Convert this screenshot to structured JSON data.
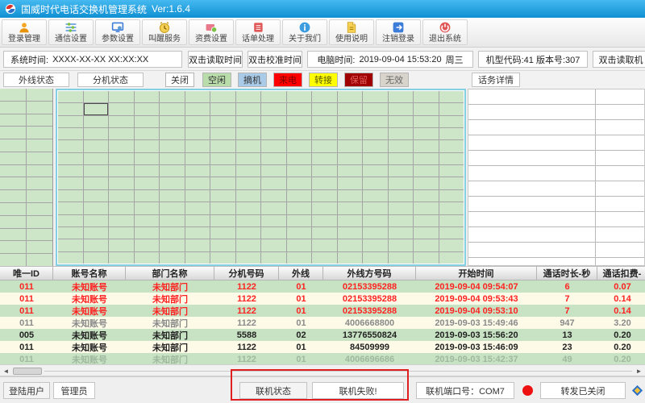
{
  "window": {
    "title": "国威时代电话交换机管理系统",
    "version": "Ver:1.6.4"
  },
  "toolbar": {
    "buttons": [
      {
        "label": "登录管理",
        "icon": "user-icon"
      },
      {
        "label": "通信设置",
        "icon": "sliders-icon"
      },
      {
        "label": "参数设置",
        "icon": "monitor-gear-icon"
      },
      {
        "label": "叫醒服务",
        "icon": "alarm-clock-icon"
      },
      {
        "label": "资费设置",
        "icon": "wallet-icon"
      },
      {
        "label": "话单处理",
        "icon": "bill-icon"
      },
      {
        "label": "关于我们",
        "icon": "info-icon"
      },
      {
        "label": "使用说明",
        "icon": "manual-icon"
      },
      {
        "label": "注销登录",
        "icon": "logout-icon"
      },
      {
        "label": "退出系统",
        "icon": "power-icon"
      }
    ]
  },
  "time_bar": {
    "system_time_label": "系统时间:",
    "system_time_value": "XXXX-XX-XX XX:XX:XX",
    "read_time_button": "双击读取时间",
    "calibrate_time_button": "双击校准时间",
    "pc_time_label": "电脑时间:",
    "pc_time_value": "2019-09-04 15:53:20",
    "pc_time_day": "周三",
    "model_info": "机型代码:41  版本号:307",
    "read_model_button": "双击读取机"
  },
  "status_row": {
    "outline_status_label": "外线状态",
    "extension_status_label": "分机状态",
    "legend": [
      {
        "label": "关闭",
        "bg": "#ffffff",
        "fg": "#333333"
      },
      {
        "label": "空闲",
        "bg": "#b9dcab",
        "fg": "#333333"
      },
      {
        "label": "摘机",
        "bg": "#a9cbe8",
        "fg": "#333333"
      },
      {
        "label": "来电",
        "bg": "#ff0000",
        "fg": "#7a0000"
      },
      {
        "label": "转接",
        "bg": "#ffff00",
        "fg": "#555500"
      },
      {
        "label": "保留",
        "bg": "#a00000",
        "fg": "#e06060"
      },
      {
        "label": "无效",
        "bg": "#d8d4cc",
        "fg": "#666666"
      }
    ],
    "call_details_label": "话务详情"
  },
  "call_table": {
    "headers": [
      "唯一ID",
      "账号名称",
      "部门名称",
      "分机号码",
      "外线",
      "外线方号码",
      "开始时间",
      "通话时长-秒",
      "通话扣费-"
    ],
    "rows": [
      {
        "style": "red",
        "cells": [
          "011",
          "未知账号",
          "未知部门",
          "1122",
          "01",
          "02153395288",
          "2019-09-04 09:54:07",
          "6",
          "0.07"
        ]
      },
      {
        "style": "red",
        "cells": [
          "011",
          "未知账号",
          "未知部门",
          "1122",
          "01",
          "02153395288",
          "2019-09-04 09:53:43",
          "7",
          "0.14"
        ]
      },
      {
        "style": "red",
        "cells": [
          "011",
          "未知账号",
          "未知部门",
          "1122",
          "01",
          "02153395288",
          "2019-09-04 09:53:10",
          "7",
          "0.14"
        ]
      },
      {
        "style": "gray",
        "cells": [
          "011",
          "未知账号",
          "未知部门",
          "1122",
          "01",
          "4006668800",
          "2019-09-03 15:49:46",
          "947",
          "3.20"
        ]
      },
      {
        "style": "dark",
        "cells": [
          "005",
          "未知账号",
          "未知部门",
          "5588",
          "02",
          "13776550824",
          "2019-09-03 15:56:20",
          "13",
          "0.20"
        ]
      },
      {
        "style": "dark",
        "cells": [
          "011",
          "未知账号",
          "未知部门",
          "1122",
          "01",
          "84509999",
          "2019-09-03 15:46:09",
          "23",
          "0.20"
        ]
      },
      {
        "style": "faded",
        "cells": [
          "011",
          "未知账号",
          "未知部门",
          "1122",
          "01",
          "4006696686",
          "2019-09-03 15:42:37",
          "49",
          "0.20"
        ]
      }
    ]
  },
  "bottom_bar": {
    "login_user_label": "登陆用户",
    "login_user_value": "管理员",
    "online_status_label": "联机状态",
    "online_status_value": "联机失败!",
    "port_label": "联机端口号：COM7",
    "forward_status": "转发已关闭"
  },
  "colors": {
    "titlebar_blue": "#1ba1e2",
    "grid_cell_green": "#cde6c8",
    "row_green": "#c8e3c3",
    "row_cream": "#fdfbe8",
    "annotation_red": "#e02020",
    "offline_dot_red": "#ee1111"
  }
}
